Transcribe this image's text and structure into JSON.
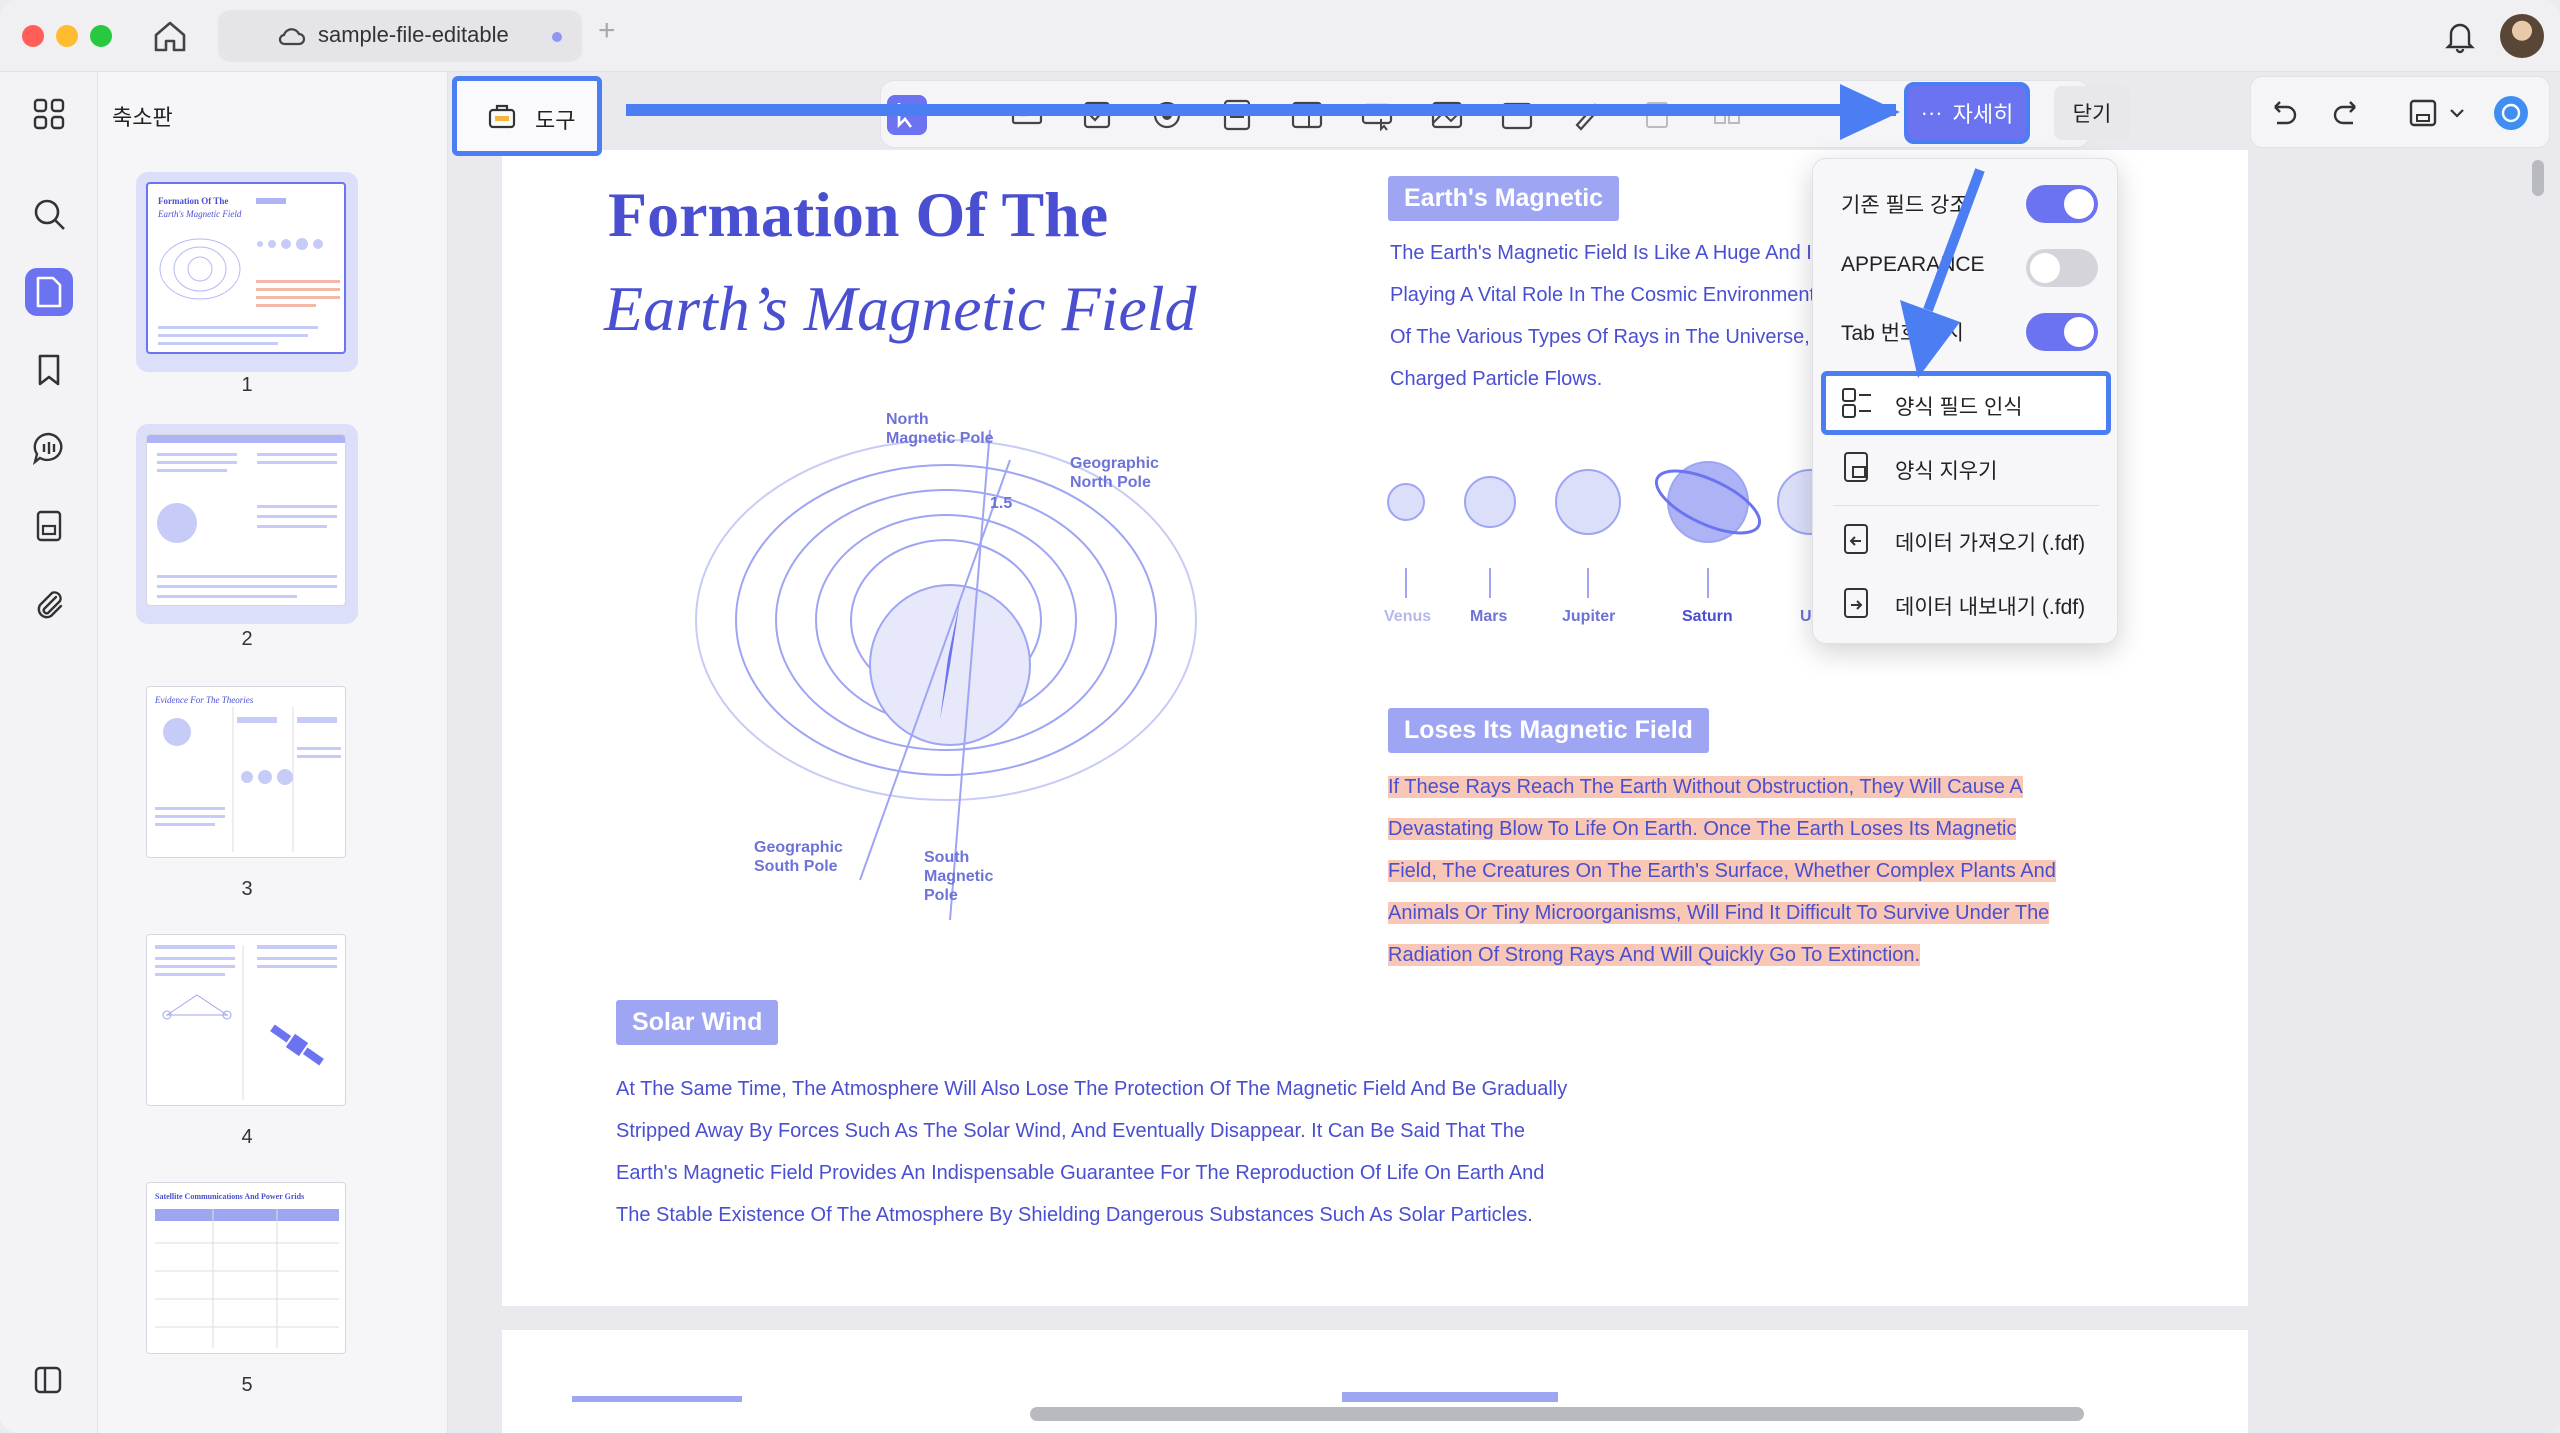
{
  "window": {
    "tab_title": "sample-file-editable"
  },
  "sidebar": {
    "header": "축소판",
    "pages": [
      "1",
      "2",
      "3",
      "4",
      "5"
    ]
  },
  "toolbar": {
    "tools_label": "도구",
    "more_label": "자세히",
    "more_icon": "···",
    "close_label": "닫기"
  },
  "dropdown": {
    "toggles": [
      {
        "label": "기존 필드 강조",
        "state": "on"
      },
      {
        "label": "APPEARANCE",
        "state": "off"
      },
      {
        "label": "Tab 번호 표시",
        "state": "on"
      }
    ],
    "items": [
      {
        "label": "양식 필드 인식",
        "selected": true
      },
      {
        "label": "양식 지우기"
      },
      {
        "label": "데이터 가져오기 (.fdf)"
      },
      {
        "label": "데이터 내보내기 (.fdf)"
      }
    ]
  },
  "document": {
    "title_line1": "Formation Of The",
    "title_line2": "Earth’s Magnetic Field",
    "section1": {
      "heading": "Earth's Magnetic",
      "lines": [
        "The Earth's Magnetic Field Is Like A Huge And Invisible Barrier,",
        "Playing A Vital Role In The Cosmic Environment",
        "Of The Various Types Of Rays in The Universe,",
        "Charged Particle Flows."
      ]
    },
    "planets": [
      "Venus",
      "Mars",
      "Jupiter",
      "Saturn",
      "U"
    ],
    "diagram_labels": {
      "north_magnetic": "North\nMagnetic Pole",
      "geo_north": "Geographic\nNorth Pole",
      "angle": "1.5",
      "geo_south": "Geographic\nSouth Pole",
      "south_magnetic": "South\nMagnetic\nPole"
    },
    "section2": {
      "heading": "Loses Its Magnetic Field",
      "lines": [
        "If These Rays Reach The Earth Without Obstruction, They Will Cause A",
        "Devastating Blow To Life On Earth. Once The Earth Loses Its Magnetic",
        "Field, The Creatures On The Earth's Surface, Whether Complex Plants And",
        "Animals Or Tiny Microorganisms, Will Find It Difficult To Survive Under The",
        "Radiation Of Strong Rays And Will Quickly Go To Extinction."
      ]
    },
    "section3": {
      "heading": "Solar Wind",
      "lines": [
        "At The Same Time, The Atmosphere Will Also Lose The Protection Of The Magnetic Field And Be Gradually",
        "Stripped Away By Forces Such As The Solar Wind, And Eventually Disappear. It Can Be Said That The",
        "Earth's Magnetic Field Provides An Indispensable Guarantee For The Reproduction Of Life On Earth And",
        "The Stable Existence Of The Atmosphere By Shielding Dangerous Substances Such As Solar Particles."
      ]
    }
  },
  "colors": {
    "accent": "#6b73f0",
    "annotation": "#4a7ef2",
    "doc_text": "#4a4fd2",
    "highlight": "#f8c7b6"
  }
}
